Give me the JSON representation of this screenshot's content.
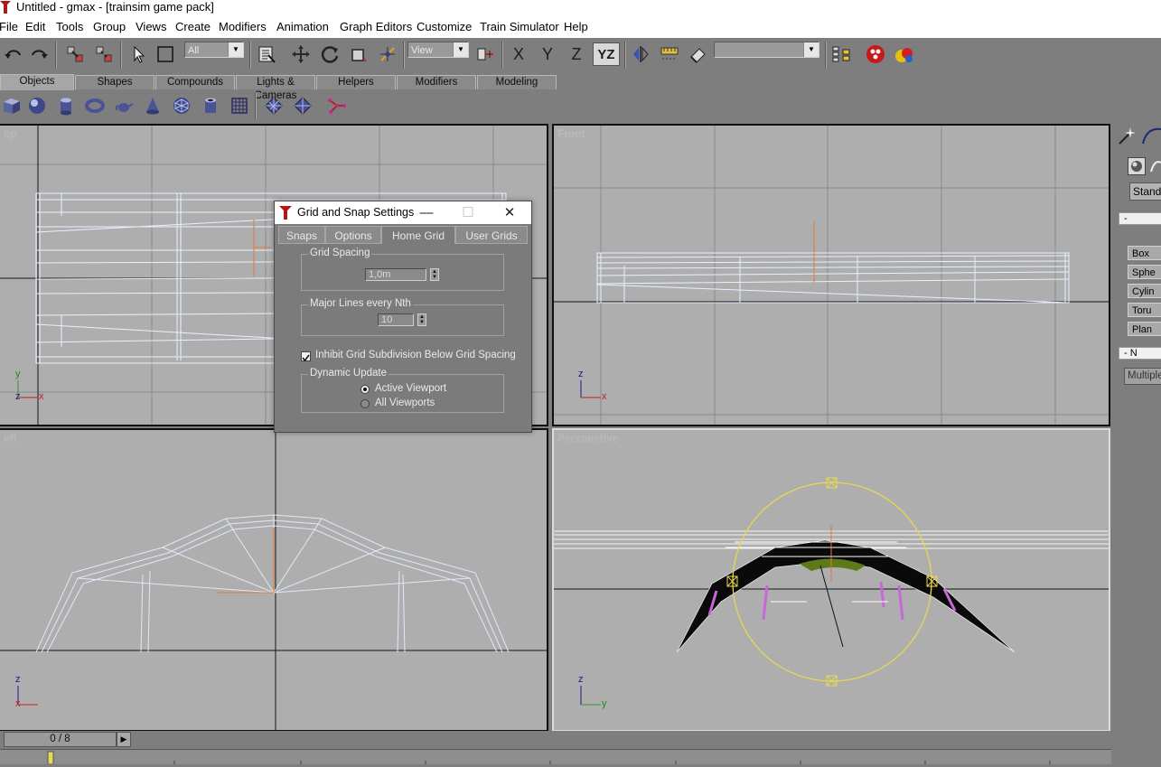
{
  "window": {
    "title": "Untitled - gmax - [trainsim game pack]"
  },
  "menu": [
    "File",
    "Edit",
    "Tools",
    "Group",
    "Views",
    "Create",
    "Modifiers",
    "Animation",
    "Graph Editors",
    "Customize",
    "Train Simulator",
    "Help"
  ],
  "toolbar": {
    "selection_filter": "All",
    "reference_coord": "View",
    "axis_x": "X",
    "axis_y": "Y",
    "axis_z": "Z",
    "axis_yz": "YZ",
    "named_selection": ""
  },
  "create_tabs": [
    "Objects",
    "Shapes",
    "Compounds",
    "Lights & Cameras",
    "Helpers",
    "Modifiers",
    "Modeling"
  ],
  "viewports": {
    "top_label": "op",
    "front_label": "Front",
    "left_label": "eft",
    "perspective_label": "Perspective",
    "top_axis": {
      "up": "y",
      "right": "x",
      "corner": "z"
    },
    "front_axis": {
      "up": "z",
      "right": "x"
    },
    "left_axis": {
      "up": "z",
      "right": "x"
    },
    "persp_axis": {
      "up": "z",
      "right": "y"
    }
  },
  "command_panel": {
    "type_dropdown": "Standa",
    "rollout1": "-",
    "buttons": [
      "Box",
      "Sphe",
      "Cylin",
      "Toru",
      "Plan"
    ],
    "rollout2": "-   N",
    "field": "Multiple"
  },
  "dialog": {
    "title": "Grid and Snap Settings",
    "tabs": [
      "Snaps",
      "Options",
      "Home Grid",
      "User Grids"
    ],
    "grid_spacing_label": "Grid Spacing",
    "grid_spacing_value": "1,0m",
    "major_lines_label": "Major Lines every Nth",
    "major_lines_value": "10",
    "inhibit_label": "Inhibit Grid Subdivision Below Grid Spacing",
    "inhibit_checked": true,
    "dynamic_update_label": "Dynamic Update",
    "active_viewport_label": "Active Viewport",
    "all_viewports_label": "All Viewports",
    "dynamic_update_selected": "Active Viewport"
  },
  "timeline": {
    "frame_display": "0 / 8"
  }
}
